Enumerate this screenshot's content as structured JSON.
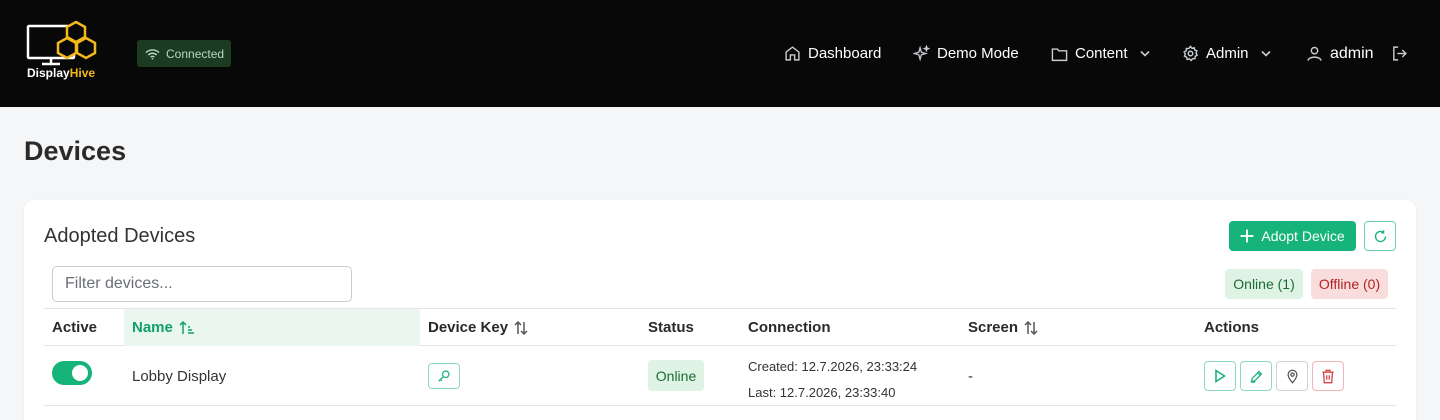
{
  "header": {
    "logo_text_a": "Display",
    "logo_text_b": "Hive",
    "connection_status": "Connected",
    "nav": {
      "dashboard": "Dashboard",
      "demo_mode": "Demo Mode",
      "content": "Content",
      "admin": "Admin",
      "user": "admin"
    }
  },
  "page": {
    "title": "Devices"
  },
  "devices_card": {
    "title": "Adopted Devices",
    "adopt_button": "Adopt Device",
    "filter_placeholder": "Filter devices...",
    "filter_value": "",
    "online_badge": "Online (1)",
    "offline_badge": "Offline (0)",
    "columns": {
      "active": "Active",
      "name": "Name",
      "device_key": "Device Key",
      "status": "Status",
      "connection": "Connection",
      "screen": "Screen",
      "actions": "Actions"
    },
    "rows": [
      {
        "active": true,
        "name": "Lobby Display",
        "status": "Online",
        "created": "Created: 12.7.2026, 23:33:24",
        "last": "Last: 12.7.2026, 23:33:40",
        "screen": "-"
      }
    ]
  },
  "colors": {
    "accent": "#16b47a",
    "header_bg": "#080808",
    "logo_accent": "#f5b81c",
    "danger": "#c83a3a"
  },
  "icons": {
    "logo": "monitor-honeycomb-icon",
    "connection": "wifi-icon",
    "dashboard": "home-icon",
    "demo_mode": "sparkles-icon",
    "content": "folder-icon",
    "admin": "gear-icon",
    "user": "user-icon",
    "logout": "logout-icon",
    "adopt": "plus-icon",
    "refresh": "refresh-icon",
    "sort": "sort-icon",
    "device_key": "key-search-icon",
    "play": "play-icon",
    "edit": "pencil-icon",
    "locate": "map-pin-icon",
    "delete": "trash-icon"
  }
}
